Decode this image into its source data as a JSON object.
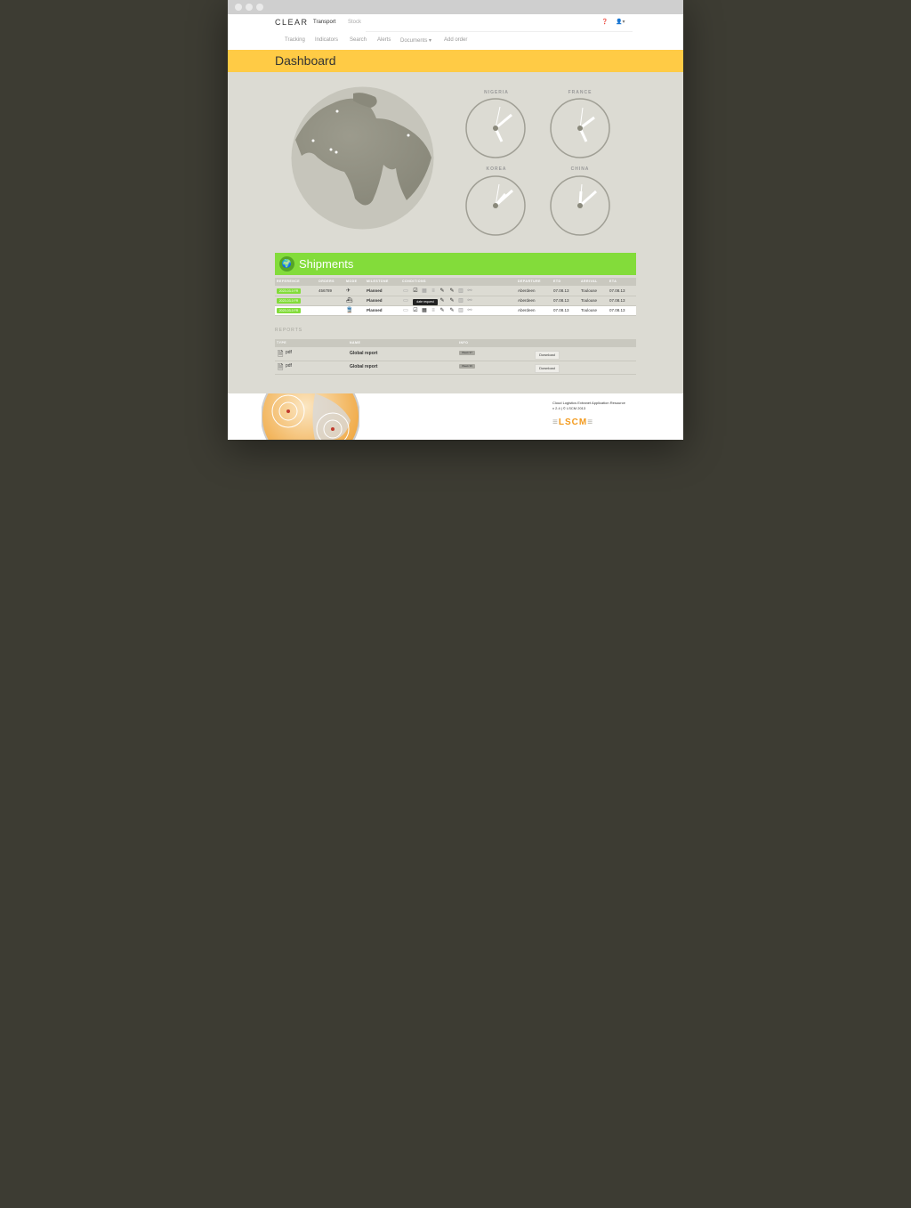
{
  "nav": {
    "logo": "CLEAR",
    "top_tabs": [
      "Transport",
      "Stock"
    ],
    "sub_items": [
      "Tracking",
      "Indicators",
      "Search",
      "Alerts",
      "Documents ▾",
      "Add order"
    ],
    "help_icon": "info-icon",
    "user_icon": "user-icon"
  },
  "page": {
    "title": "Dashboard"
  },
  "clocks": [
    {
      "label": "NIGERIA"
    },
    {
      "label": "FRANCE"
    },
    {
      "label": "KOREA"
    },
    {
      "label": "CHINA"
    }
  ],
  "shipments": {
    "title": "Shipments",
    "columns": [
      "REFERENCE",
      "ORDERS",
      "MODE",
      "MILESTONE",
      "CONDITIONS",
      "DEPARTURE",
      "ETD",
      "ARRIVAL",
      "ETA"
    ],
    "rows": [
      {
        "reference": "2023-03-0 FR",
        "orders": "456789",
        "mode": "air",
        "milestone": "Planned",
        "departure": "Aberdeen",
        "etd": "07.08.13",
        "arrival": "Toulouse",
        "eta": "07.08.13"
      },
      {
        "reference": "2023-03-0 FR",
        "orders": "",
        "mode": "sea",
        "milestone": "Planned",
        "departure": "Aberdeen",
        "etd": "07.08.13",
        "arrival": "Toulouse",
        "eta": "07.08.13"
      },
      {
        "reference": "2023-03-0 FR",
        "orders": "",
        "mode": "rail",
        "milestone": "Planned",
        "departure": "Aberdeen",
        "etd": "07.08.13",
        "arrival": "Toulouse",
        "eta": "07.08.13"
      }
    ],
    "tooltip": "date request"
  },
  "reports": {
    "title": "REPORTS",
    "columns": [
      "TYPE",
      "NAME",
      "INFO"
    ],
    "rows": [
      {
        "type": "pdf",
        "name": "Global report",
        "info": "Week 37",
        "action": "Download"
      },
      {
        "type": "pdf",
        "name": "Global report",
        "info": "Week 36",
        "action": "Download"
      }
    ]
  },
  "footer": {
    "line1": "Cloud Logistics Extranet Application Resource",
    "line2": "v 2.4 | © LSCM 2013",
    "brand": "LSCM"
  },
  "colors": {
    "dashbar": "#ffcb45",
    "shipments": "#83dc3a",
    "background": "#3d3c33",
    "lscm": "#f39a1c"
  }
}
